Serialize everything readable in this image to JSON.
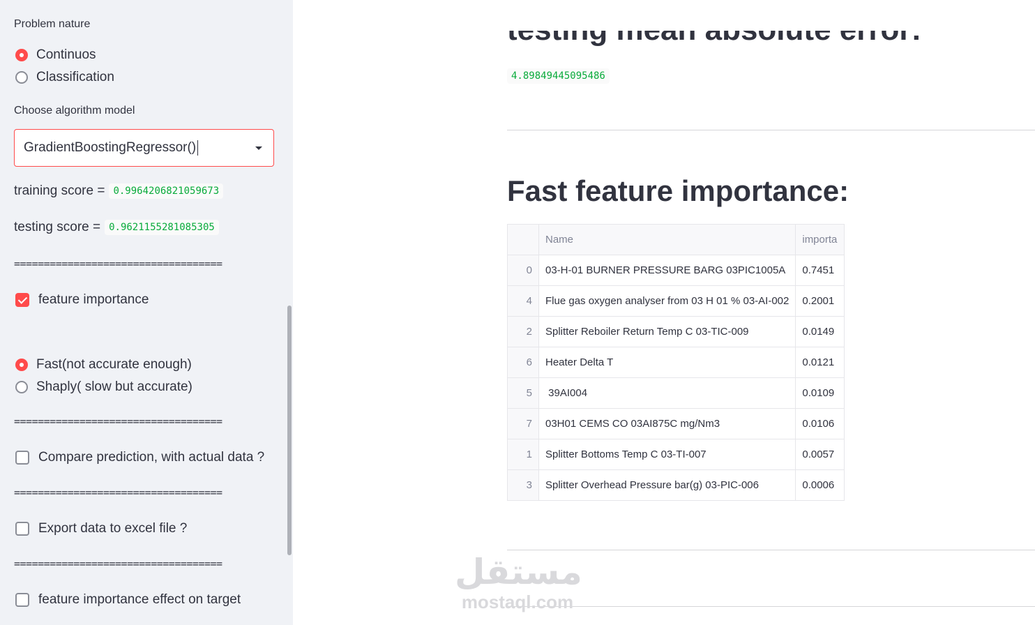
{
  "sidebar": {
    "problem_nature_label": "Problem nature",
    "problem_nature_options": [
      "Continuos",
      "Classification"
    ],
    "problem_nature_selected": "Continuos",
    "algorithm_label": "Choose algorithm model",
    "algorithm_value": "GradientBoostingRegressor()",
    "training_score_label": "training score =",
    "training_score_value": "0.9964206821059673",
    "testing_score_label": "testing score =",
    "testing_score_value": "0.9621155281085305",
    "separator": "===================================",
    "feature_importance_label": "feature importance",
    "feature_importance_checked": true,
    "importance_method_options": [
      "Fast(not accurate enough)",
      "Shaply( slow but accurate)"
    ],
    "importance_method_selected": "Fast(not accurate enough)",
    "compare_label": "Compare prediction, with actual data ?",
    "export_label": "Export data to excel file ?",
    "effect_label": "feature importance effect on target"
  },
  "main": {
    "mae_title": "testing mean absolute error:",
    "mae_value": "4.89849445095486",
    "feature_title": "Fast feature importance:",
    "table": {
      "headers": [
        "",
        "Name",
        "importa"
      ],
      "rows": [
        {
          "idx": "0",
          "name": "03-H-01 BURNER PRESSURE BARG 03PIC1005A",
          "value": "0.7451"
        },
        {
          "idx": "4",
          "name": "Flue gas oxygen analyser from 03 H 01 % 03-AI-002",
          "value": "0.2001"
        },
        {
          "idx": "2",
          "name": "Splitter Reboiler Return Temp C 03-TIC-009",
          "value": "0.0149"
        },
        {
          "idx": "6",
          "name": "Heater Delta T",
          "value": "0.0121"
        },
        {
          "idx": "5",
          "name": " 39AI004",
          "value": "0.0109"
        },
        {
          "idx": "7",
          "name": "03H01 CEMS CO 03AI875C mg/Nm3",
          "value": "0.0106"
        },
        {
          "idx": "1",
          "name": "Splitter Bottoms Temp C 03-TI-007",
          "value": "0.0057"
        },
        {
          "idx": "3",
          "name": "Splitter Overhead Pressure bar(g) 03-PIC-006",
          "value": "0.0006"
        }
      ]
    }
  },
  "watermark": {
    "arabic": "مستقل",
    "latin": "mostaql.com"
  },
  "colors": {
    "accent": "#ff4b4b",
    "code_green": "#09ab3b",
    "sidebar_bg": "#f0f2f6"
  }
}
